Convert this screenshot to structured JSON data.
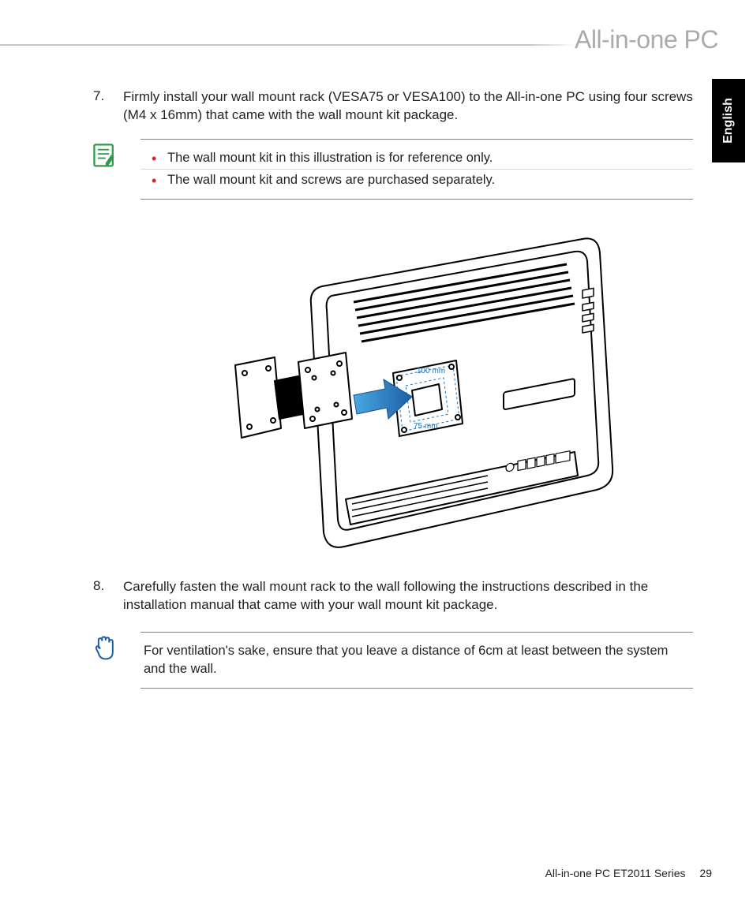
{
  "header": {
    "title": "All-in-one PC"
  },
  "language_tab": "English",
  "steps": [
    {
      "number": "7.",
      "text": "Firmly install your wall mount rack (VESA75 or VESA100) to the All-in-one PC using four screws (M4 x 16mm) that came with the wall mount kit package."
    },
    {
      "number": "8.",
      "text": "Carefully fasten the wall mount rack to the wall following the instructions described in the installation manual that came with your wall mount kit package."
    }
  ],
  "note1": {
    "items": [
      "The wall mount kit in this illustration is for reference only.",
      "The wall mount kit and screws are purchased separately."
    ]
  },
  "note2": {
    "text": "For ventilation's sake, ensure that you leave a distance of 6cm at least between the system and the wall."
  },
  "illustration": {
    "dim_outer": "100 mm",
    "dim_inner": "75 mm"
  },
  "footer": {
    "series": "All-in-one PC ET2011 Series",
    "page": "29"
  }
}
